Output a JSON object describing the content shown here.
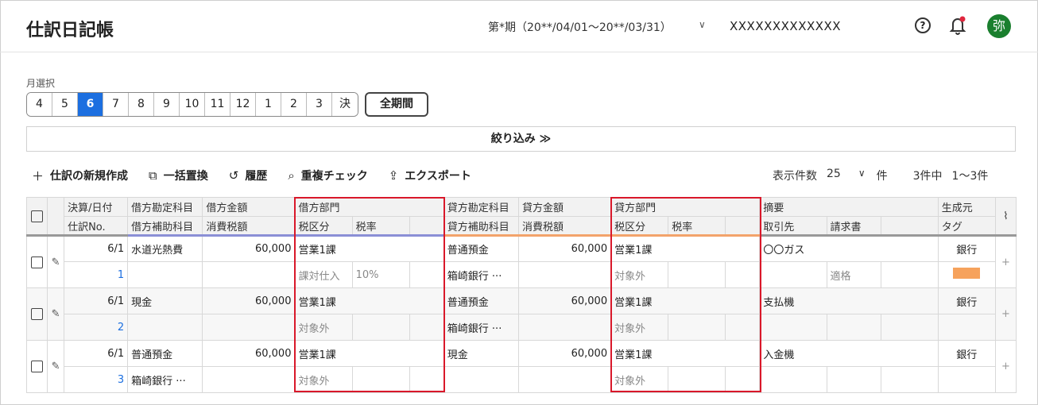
{
  "header": {
    "title": "仕訳日記帳",
    "period": "第*期（20**/04/01〜20**/03/31）",
    "period_chevron": "∨",
    "company": "XXXXXXXXXXXXX",
    "help": "?",
    "avatar": "弥"
  },
  "month_select": {
    "label": "月選択",
    "months": [
      "4",
      "5",
      "6",
      "7",
      "8",
      "9",
      "10",
      "11",
      "12",
      "1",
      "2",
      "3",
      "決"
    ],
    "active": "6",
    "all_label": "全期間"
  },
  "filter": {
    "label": "絞り込み ≫"
  },
  "toolbar": {
    "new": "仕訳の新規作成",
    "replace": "一括置換",
    "history": "履歴",
    "dup": "重複チェック",
    "export": "エクスポート"
  },
  "pager": {
    "label": "表示件数",
    "count": "25",
    "chev": "∨",
    "unit": "件",
    "total": "3件中",
    "range": "1〜3件"
  },
  "table": {
    "headers": {
      "h1a": "決算/日付",
      "h1b": "仕訳No.",
      "h2a": "借方勘定科目",
      "h2b": "借方補助科目",
      "h3a": "借方金額",
      "h3b": "消費税額",
      "h4a": "借方部門",
      "h4b": "税区分",
      "h4c": "税率",
      "h5a": "貸方勘定科目",
      "h5b": "貸方補助科目",
      "h6a": "貸方金額",
      "h6b": "消費税額",
      "h7a": "貸方部門",
      "h7b": "税区分",
      "h7c": "税率",
      "h8a": "摘要",
      "h8b": "取引先",
      "h8c": "請求書",
      "h9a": "生成元",
      "h9b": "タグ"
    },
    "rows": [
      {
        "date": "6/1",
        "no": "1",
        "debit_acct": "水道光熱費",
        "debit_sub": "",
        "debit_amt": "60,000",
        "debit_dept": "営業1課",
        "debit_tax": "課対仕入",
        "debit_rate": "10%",
        "credit_acct": "普通預金",
        "credit_sub": "箱崎銀行 ···",
        "credit_amt": "60,000",
        "credit_dept": "営業1課",
        "credit_tax": "対象外",
        "memo": "〇〇ガス",
        "invoice": "適格",
        "source": "銀行"
      },
      {
        "date": "6/1",
        "no": "2",
        "debit_acct": "現金",
        "debit_sub": "",
        "debit_amt": "60,000",
        "debit_dept": "営業1課",
        "debit_tax": "対象外",
        "debit_rate": "",
        "credit_acct": "普通預金",
        "credit_sub": "箱崎銀行 ···",
        "credit_amt": "60,000",
        "credit_dept": "営業1課",
        "credit_tax": "対象外",
        "memo": "支払機",
        "invoice": "",
        "source": "銀行"
      },
      {
        "date": "6/1",
        "no": "3",
        "debit_acct": "普通預金",
        "debit_sub": "箱崎銀行 ···",
        "debit_amt": "60,000",
        "debit_dept": "営業1課",
        "debit_tax": "対象外",
        "debit_rate": "",
        "credit_acct": "現金",
        "credit_sub": "",
        "credit_amt": "60,000",
        "credit_dept": "営業1課",
        "credit_tax": "対象外",
        "memo": "入金機",
        "invoice": "",
        "source": "銀行"
      }
    ]
  },
  "colors": {
    "accent": "#1c6fe0",
    "highlight": "#d9182a",
    "tag": "#f6a25c"
  }
}
